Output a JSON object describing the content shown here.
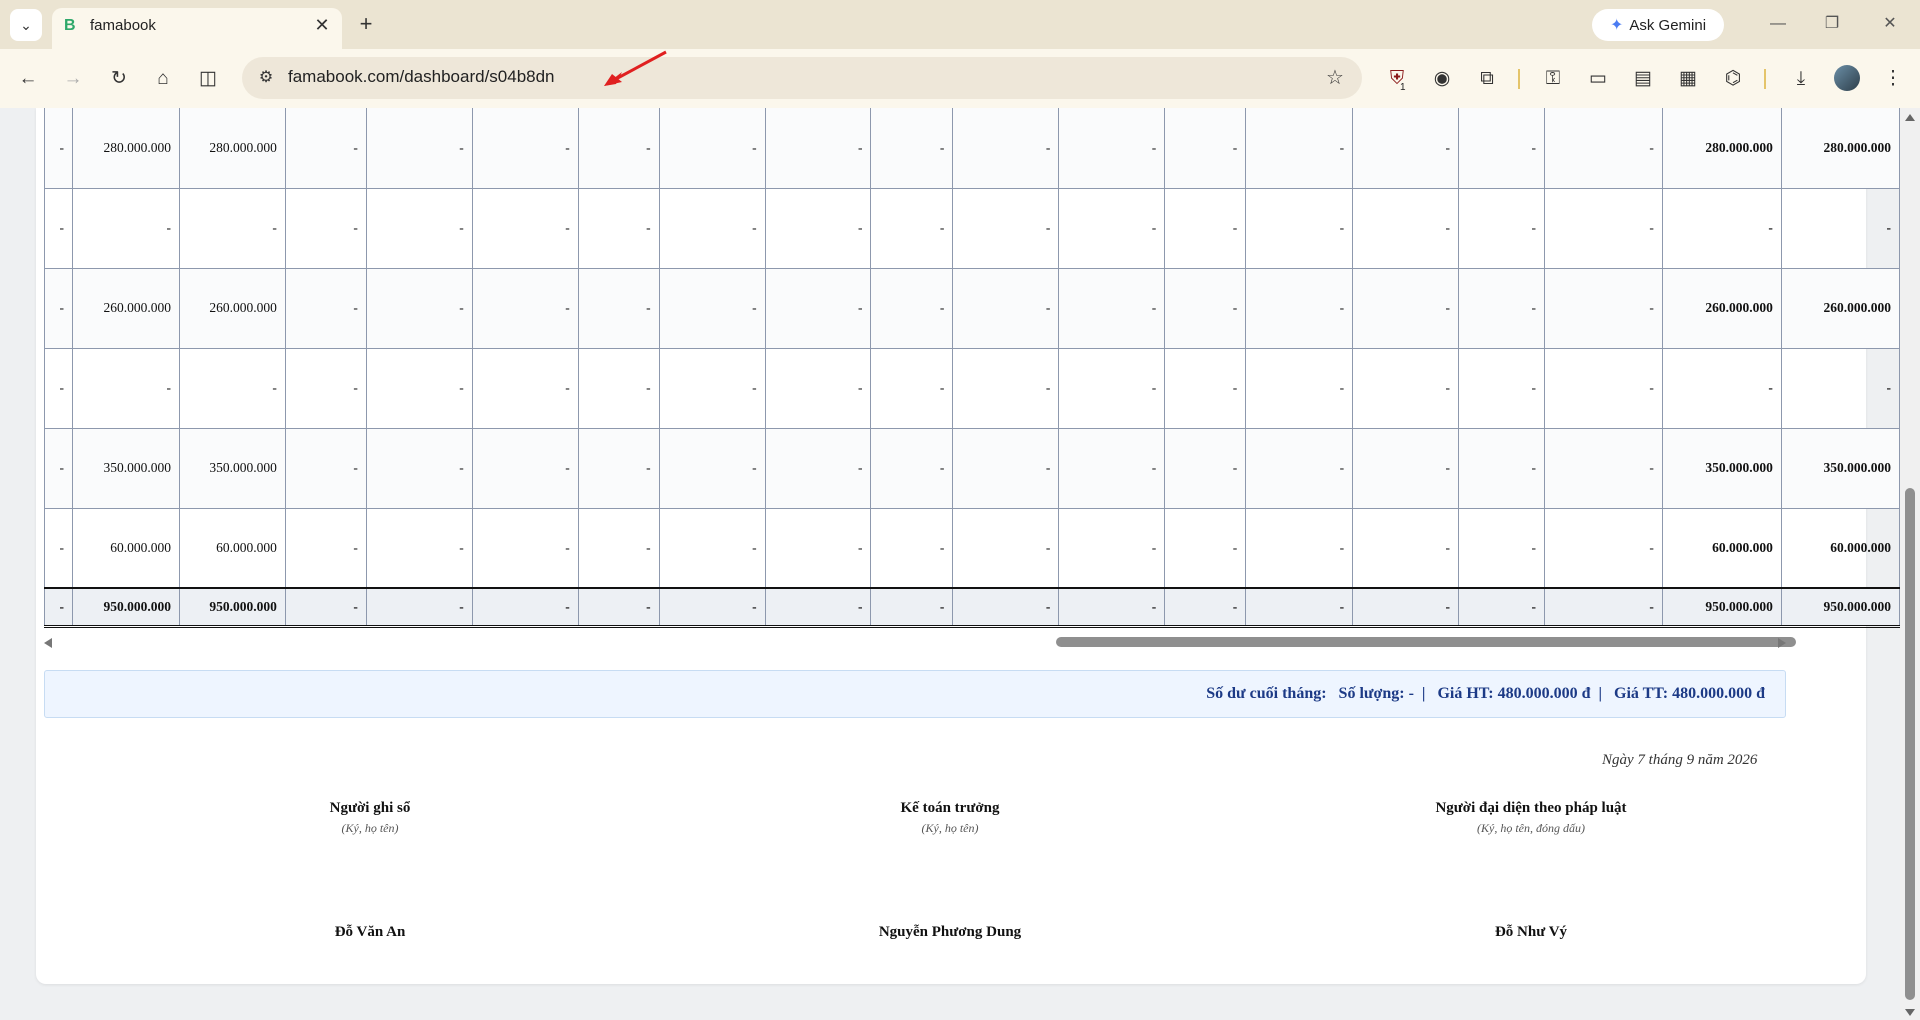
{
  "browser": {
    "tab_title": "famabook",
    "tab_favicon": "B",
    "url": "famabook.com/dashboard/s04b8dn",
    "gemini_label": "Ask Gemini",
    "extension_badge": "1"
  },
  "ledger": {
    "rows": [
      [
        "-",
        "280.000.000",
        "280.000.000",
        "-",
        "-",
        "-",
        "-",
        "-",
        "-",
        "-",
        "-",
        "-",
        "-",
        "-",
        "-",
        "-",
        "-",
        "280.000.000",
        "280.000.000"
      ],
      [
        "-",
        "-",
        "-",
        "-",
        "-",
        "-",
        "-",
        "-",
        "-",
        "-",
        "-",
        "-",
        "-",
        "-",
        "-",
        "-",
        "-",
        "-",
        "-"
      ],
      [
        "-",
        "260.000.000",
        "260.000.000",
        "-",
        "-",
        "-",
        "-",
        "-",
        "-",
        "-",
        "-",
        "-",
        "-",
        "-",
        "-",
        "-",
        "-",
        "260.000.000",
        "260.000.000"
      ],
      [
        "-",
        "-",
        "-",
        "-",
        "-",
        "-",
        "-",
        "-",
        "-",
        "-",
        "-",
        "-",
        "-",
        "-",
        "-",
        "-",
        "-",
        "-",
        "-"
      ],
      [
        "-",
        "350.000.000",
        "350.000.000",
        "-",
        "-",
        "-",
        "-",
        "-",
        "-",
        "-",
        "-",
        "-",
        "-",
        "-",
        "-",
        "-",
        "-",
        "350.000.000",
        "350.000.000"
      ],
      [
        "-",
        "60.000.000",
        "60.000.000",
        "-",
        "-",
        "-",
        "-",
        "-",
        "-",
        "-",
        "-",
        "-",
        "-",
        "-",
        "-",
        "-",
        "-",
        "60.000.000",
        "60.000.000"
      ]
    ],
    "total_row": [
      "-",
      "950.000.000",
      "950.000.000",
      "-",
      "-",
      "-",
      "-",
      "-",
      "-",
      "-",
      "-",
      "-",
      "-",
      "-",
      "-",
      "-",
      "-",
      "950.000.000",
      "950.000.000"
    ]
  },
  "summary": {
    "label": "Số dư cuối tháng:",
    "quantity": "Số lượng: -",
    "price_ht": "Giá HT: 480.000.000 đ",
    "price_tt": "Giá TT: 480.000.000 đ",
    "separator": "|"
  },
  "date_line": "Ngày 7 tháng 9 năm 2026",
  "signatures": [
    {
      "role": "Người ghi sổ",
      "hint": "(Ký, họ tên)",
      "name": "Đỗ Văn An"
    },
    {
      "role": "Kế toán trưởng",
      "hint": "(Ký, họ tên)",
      "name": "Nguyễn Phương Dung"
    },
    {
      "role": "Người đại diện theo pháp luật",
      "hint": "(Ký, họ tên, đóng dấu)",
      "name": "Đỗ Như Vý"
    }
  ],
  "icons": {
    "tab_search": "chevron-down-icon",
    "back": "back-arrow-icon",
    "forward": "forward-arrow-icon",
    "reload": "reload-icon",
    "home": "home-icon",
    "split": "split-view-icon",
    "tune": "site-settings-icon",
    "bookmark": "star-icon",
    "download": "download-icon",
    "menu": "kebab-menu-icon"
  }
}
